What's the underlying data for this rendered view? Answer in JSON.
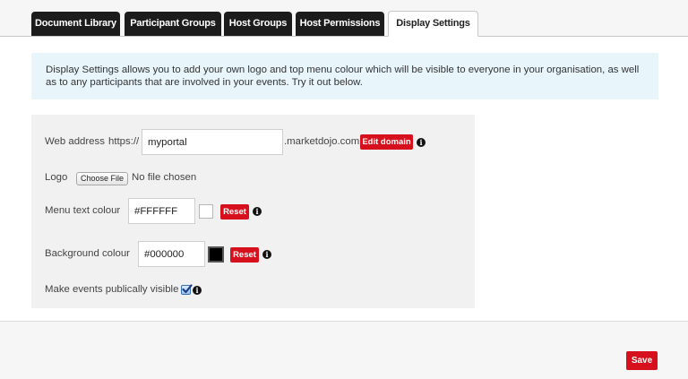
{
  "tabs": [
    {
      "label": "Document Library"
    },
    {
      "label": "Participant Groups"
    },
    {
      "label": "Host Groups"
    },
    {
      "label": "Host Permissions"
    },
    {
      "label": "Display Settings",
      "active": true
    }
  ],
  "info": {
    "text": "Display Settings allows you to add your own logo and top menu colour which will be visible to everyone in your organisation, as well as to any participants that are involved in your events. Try it out below."
  },
  "form": {
    "web_address": {
      "label": "Web address",
      "prefix": "https://",
      "value": "myportal",
      "suffix": ".marketdojo.com",
      "edit_button": "Edit domain"
    },
    "logo": {
      "label": "Logo",
      "choose_button": "Choose File",
      "status": "No file chosen"
    },
    "menu_text_colour": {
      "label": "Menu text colour",
      "value": "#FFFFFF",
      "swatch_color": "#ffffff",
      "reset_button": "Reset"
    },
    "background_colour": {
      "label": "Background colour",
      "value": "#000000",
      "swatch_color": "#000000",
      "reset_button": "Reset"
    },
    "public_events": {
      "label": "Make events publically visible",
      "checked": true
    }
  },
  "footer": {
    "save_button": "Save"
  },
  "colors": {
    "accent_red": "#d6101c",
    "tab_dark": "#1c1c1c",
    "info_bg": "#e8f6fc",
    "form_bg": "#f1f1f1"
  },
  "icons": {
    "info": "info-circle-icon",
    "check": "checkmark-icon",
    "swatch": "color-swatch-icon"
  }
}
